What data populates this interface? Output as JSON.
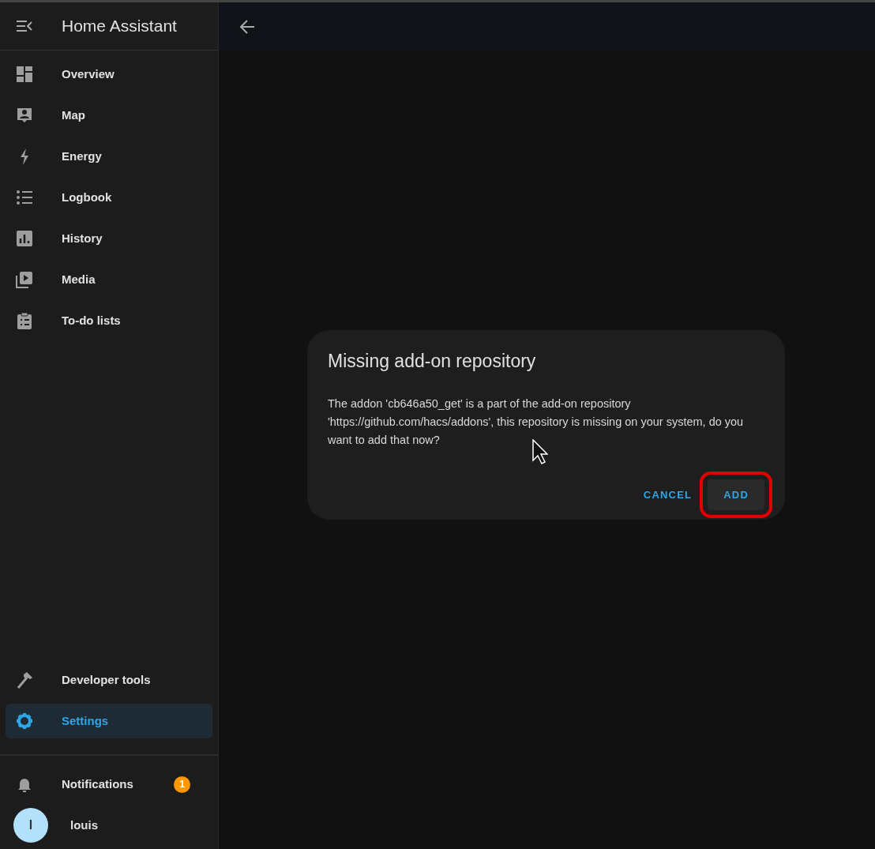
{
  "sidebar": {
    "title": "Home Assistant",
    "items": [
      {
        "label": "Overview",
        "selected": false
      },
      {
        "label": "Map",
        "selected": false
      },
      {
        "label": "Energy",
        "selected": false
      },
      {
        "label": "Logbook",
        "selected": false
      },
      {
        "label": "History",
        "selected": false
      },
      {
        "label": "Media",
        "selected": false
      },
      {
        "label": "To-do lists",
        "selected": false
      }
    ],
    "bottom_items": [
      {
        "label": "Developer tools",
        "selected": false
      },
      {
        "label": "Settings",
        "selected": true
      }
    ],
    "notifications": {
      "label": "Notifications",
      "count": "1"
    },
    "user": {
      "initial": "l",
      "name": "louis"
    }
  },
  "dialog": {
    "title": "Missing add-on repository",
    "message": "The addon 'cb646a50_get' is a part of the add-on repository 'https://github.com/hacs/addons', this repository is missing on your system, do you want to add that now?",
    "buttons": [
      {
        "label": "CANCEL",
        "highlighted": false
      },
      {
        "label": "ADD",
        "highlighted": true
      }
    ]
  }
}
